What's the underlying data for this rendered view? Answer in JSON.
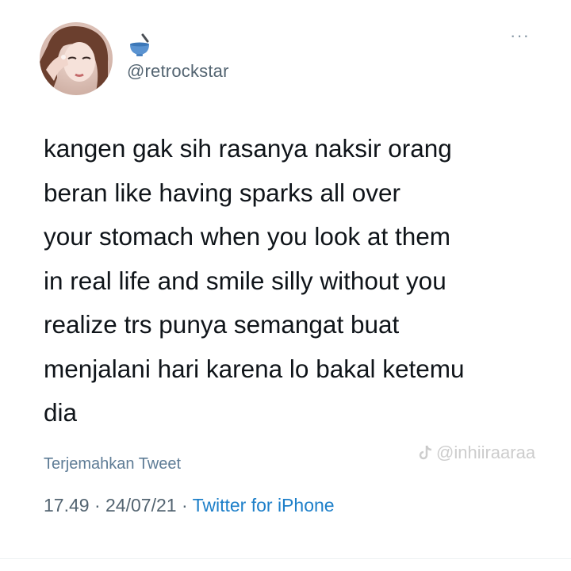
{
  "tweet": {
    "handle": "@retrockstar",
    "name_emoji": "bowl-with-spoon-icon",
    "text": "kangen gak sih rasanya naksir orang\nberan like having sparks all over\nyour stomach when you look at them\nin real life and smile silly without you\nrealize trs punya semangat buat\nmenjalani hari karena lo bakal ketemu\ndia",
    "translate_label": "Terjemahkan Tweet",
    "time": "17.49",
    "date": "24/07/21",
    "separator": "·",
    "source": "Twitter for iPhone"
  },
  "watermark": {
    "text": "@inhiiraaraa",
    "icon": "tiktok-icon"
  },
  "colors": {
    "text": "#0f1419",
    "secondary": "#536471",
    "link": "#1d7fc9",
    "translate": "#5e7c96",
    "bowl": "#5a93d1"
  }
}
